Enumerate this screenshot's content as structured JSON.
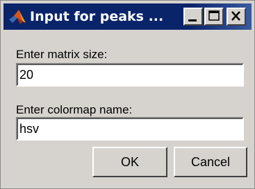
{
  "window": {
    "title": "Input for peaks ...",
    "app_icon": "matlab-logo-icon",
    "controls": {
      "minimize_icon": "minimize-icon",
      "maximize_icon": "maximize-icon",
      "close_icon": "close-icon"
    }
  },
  "form": {
    "matrix_size": {
      "label": "Enter matrix size:",
      "value": "20"
    },
    "colormap": {
      "label": "Enter colormap name:",
      "value": "hsv"
    }
  },
  "buttons": {
    "ok_label": "OK",
    "cancel_label": "Cancel"
  },
  "colors": {
    "titlebar": "#0a246a",
    "dialog_background": "#d6d3ce",
    "field_background": "#ffffff"
  }
}
